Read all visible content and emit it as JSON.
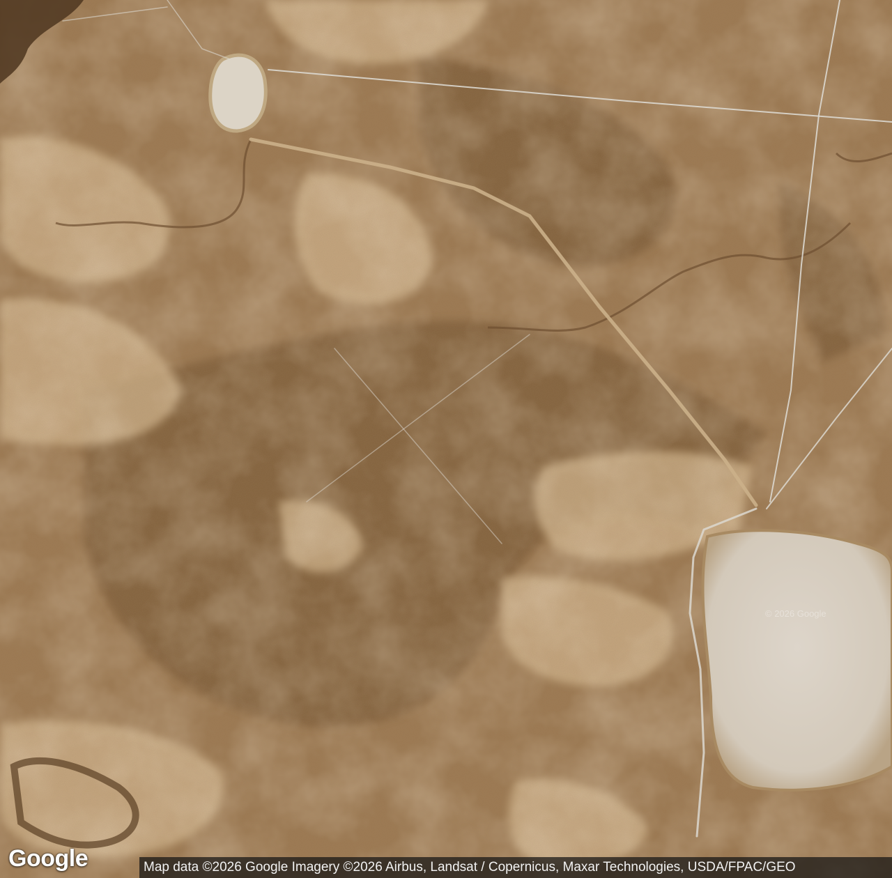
{
  "map": {
    "type": "satellite",
    "provider_logo": "Google",
    "attribution": "Map data ©2026 Google Imagery ©2026 Airbus, Landsat / Copernicus, Maxar Technologies, USDA/FPAC/GEO",
    "watermark": "© 2026 Google",
    "colors": {
      "terrain_base": "#9c7a52",
      "terrain_dark": "#7a5a36",
      "terrain_light": "#c9ab80",
      "salt_flat": "#d8d0c4",
      "road": "#d9d6d0"
    }
  }
}
